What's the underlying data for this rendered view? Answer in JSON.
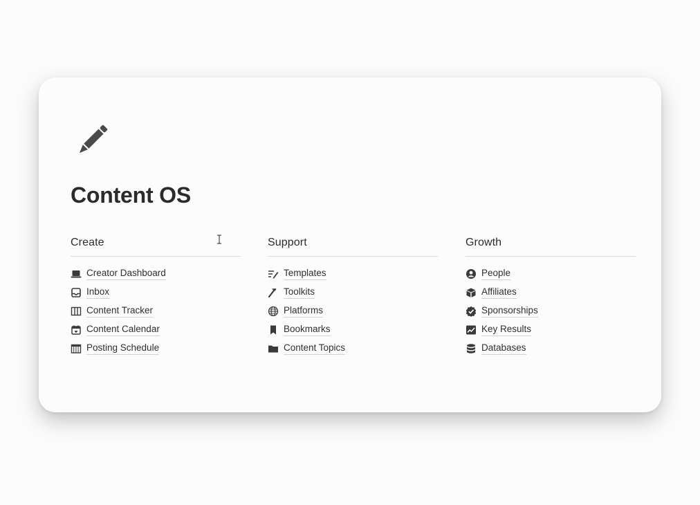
{
  "page": {
    "icon": "pencil-icon",
    "title": "Content OS"
  },
  "columns": [
    {
      "heading": "Create",
      "items": [
        {
          "label": "Creator Dashboard",
          "icon": "laptop-icon"
        },
        {
          "label": "Inbox",
          "icon": "inbox-icon"
        },
        {
          "label": "Content Tracker",
          "icon": "board-columns-icon"
        },
        {
          "label": "Content Calendar",
          "icon": "calendar-icon"
        },
        {
          "label": "Posting Schedule",
          "icon": "schedule-grid-icon"
        }
      ]
    },
    {
      "heading": "Support",
      "items": [
        {
          "label": "Templates",
          "icon": "list-pen-icon"
        },
        {
          "label": "Toolkits",
          "icon": "hammer-icon"
        },
        {
          "label": "Platforms",
          "icon": "globe-icon"
        },
        {
          "label": "Bookmarks",
          "icon": "bookmark-icon"
        },
        {
          "label": "Content Topics",
          "icon": "folder-icon"
        }
      ]
    },
    {
      "heading": "Growth",
      "items": [
        {
          "label": "People",
          "icon": "person-circle-icon"
        },
        {
          "label": "Affiliates",
          "icon": "box-icon"
        },
        {
          "label": "Sponsorships",
          "icon": "verified-badge-icon"
        },
        {
          "label": "Key Results",
          "icon": "chart-line-icon"
        },
        {
          "label": "Databases",
          "icon": "database-icon"
        }
      ]
    }
  ],
  "colors": {
    "text": "#2f2f2f",
    "divider": "#dcdcdc",
    "card": "#fcfcfc",
    "background": "#fbfbfb"
  }
}
